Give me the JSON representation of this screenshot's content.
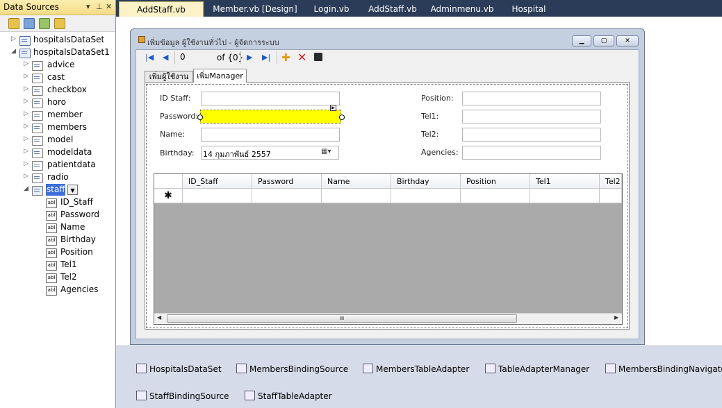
{
  "data_sources": {
    "title": "Data Sources",
    "title_buttons": [
      "▾",
      "⊥",
      "✕"
    ],
    "toolbar_icons": [
      "add-datasource-icon",
      "edit-dataset-icon",
      "configure-dataset-icon",
      "refresh-icon"
    ],
    "tree": {
      "root1": "hospitalsDataSet",
      "root2": "hospitalsDataSet1",
      "tables": [
        "advice",
        "cast",
        "checkbox",
        "horo",
        "member",
        "members",
        "model",
        "modeldata",
        "patientdata",
        "radio"
      ],
      "staff": "staff",
      "staff_fields": [
        "ID_Staff",
        "Password",
        "Name",
        "Birthday",
        "Position",
        "Tel1",
        "Tel2",
        "Agencies"
      ],
      "field_icon_text": "abl"
    }
  },
  "doc_tabs": [
    "AddStaff.vb [Design]",
    "Member.vb [Design]",
    "Login.vb",
    "AddStaff.vb",
    "Adminmenu.vb",
    "Hospital"
  ],
  "form": {
    "title": "เพิ่มข้อมูล ผู้ใช้งานทั่วไป - ผู้จัดการระบบ",
    "navigator": {
      "position": "0",
      "count": "of {0}"
    },
    "tabs": [
      "เพิ่มผู้ใช้งาน",
      "เพิ่มManager"
    ],
    "labels": {
      "id_staff": "ID Staff:",
      "password": "Password:",
      "name": "Name:",
      "birthday": "Birthday:",
      "position": "Position:",
      "tel1": "Tel1:",
      "tel2": "Tel2:",
      "agencies": "Agencies:"
    },
    "birthday_value": "14  กุมภาพันธ์   2557",
    "grid_columns": [
      "ID_Staff",
      "Password",
      "Name",
      "Birthday",
      "Position",
      "Tel1",
      "Tel2"
    ],
    "new_row_marker": "✱",
    "scroll_thumb_grip": "III"
  },
  "tray": [
    "HospitalsDataSet",
    "MembersBindingSource",
    "MembersTableAdapter",
    "TableAdapterManager",
    "MembersBindingNavigator",
    "StaffBindingSource",
    "StaffTableAdapter"
  ]
}
